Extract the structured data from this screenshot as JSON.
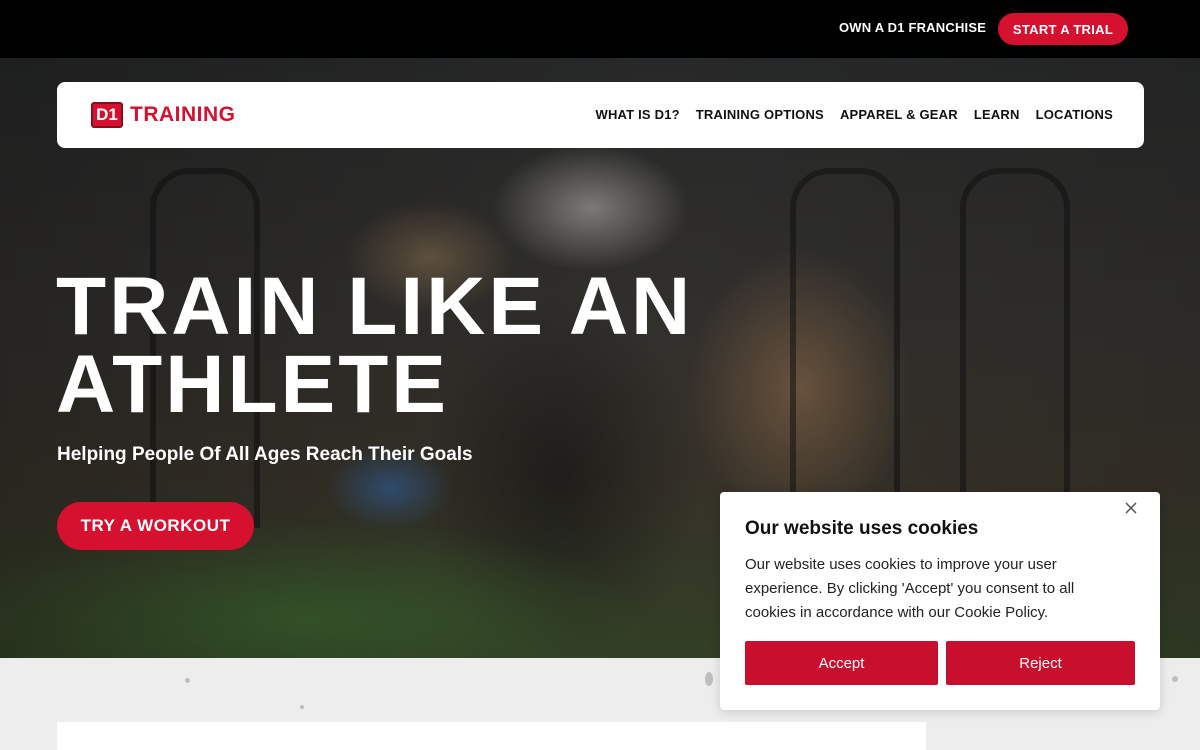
{
  "topbar": {
    "franchise_link": "OWN A D1 FRANCHISE",
    "trial_button": "START A TRIAL"
  },
  "header": {
    "logo": {
      "mark": "D1",
      "word": "TRAINING"
    },
    "nav": [
      {
        "label": "WHAT IS D1?"
      },
      {
        "label": "TRAINING OPTIONS"
      },
      {
        "label": "APPAREL & GEAR"
      },
      {
        "label": "LEARN"
      },
      {
        "label": "LOCATIONS"
      }
    ]
  },
  "hero": {
    "headline_line1": "TRAIN LIKE AN",
    "headline_line2": "ATHLETE",
    "subheadline": "Helping People Of All Ages Reach Their Goals",
    "cta": "TRY A WORKOUT"
  },
  "cookie_banner": {
    "title": "Our website uses cookies",
    "body": "Our website uses cookies to improve your user experience. By clicking 'Accept' you consent to all cookies in accordance with our Cookie Policy.",
    "accept": "Accept",
    "reject": "Reject",
    "close_icon": "close-icon"
  },
  "colors": {
    "brand_red": "#d6112f",
    "topbar_bg": "#000000"
  }
}
